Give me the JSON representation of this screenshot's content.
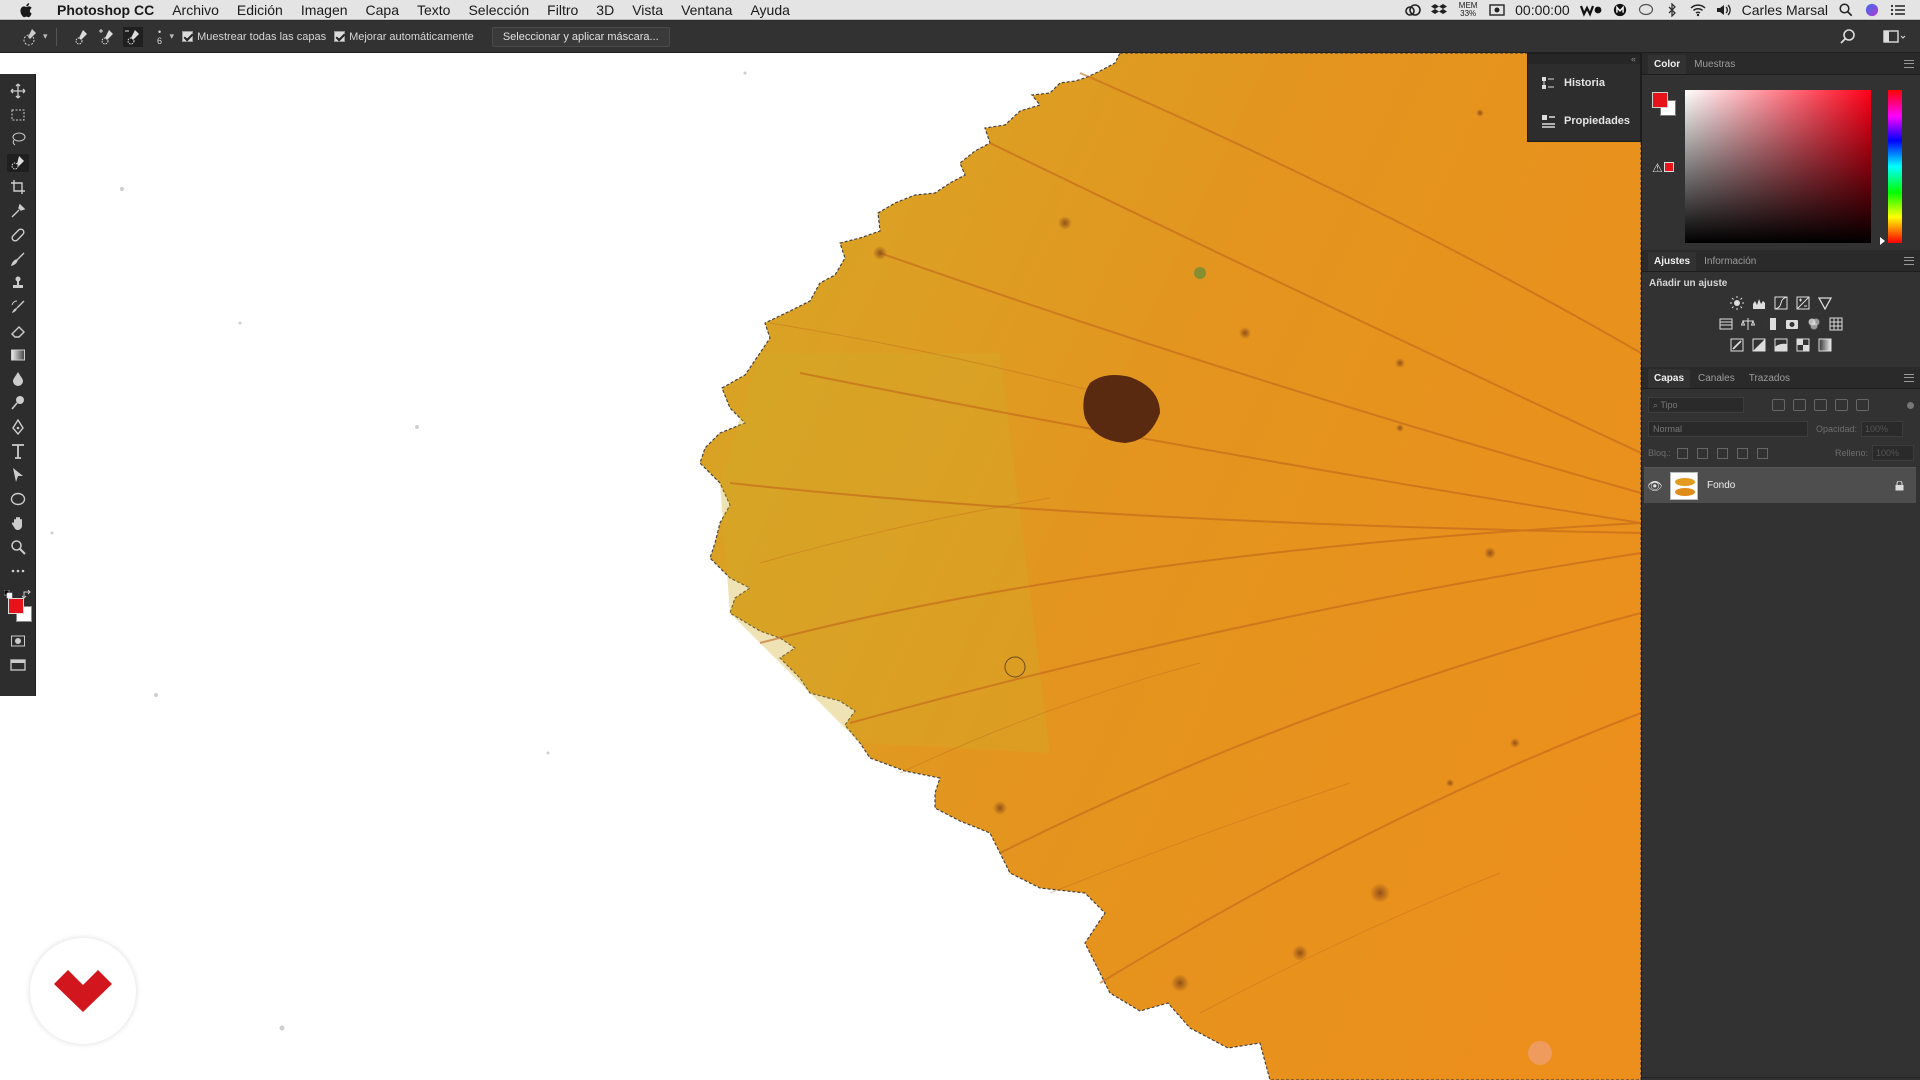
{
  "menubar": {
    "app_name": "Photoshop CC",
    "items": [
      "Archivo",
      "Edición",
      "Imagen",
      "Capa",
      "Texto",
      "Selección",
      "Filtro",
      "3D",
      "Vista",
      "Ventana",
      "Ayuda"
    ],
    "mem_label": "MEM",
    "mem_value": "33%",
    "clock": "00:00:00",
    "user": "Carles Marsal"
  },
  "options_bar": {
    "brush_size": "6",
    "sample_all_layers": "Muestrear todas las capas",
    "auto_enhance": "Mejorar automáticamente",
    "select_and_mask": "Seleccionar y aplicar máscara..."
  },
  "collapsed_panels": {
    "history": "Historia",
    "properties": "Propiedades"
  },
  "color_panel": {
    "tabs": [
      "Color",
      "Muestras"
    ],
    "foreground_color": "#e8131a",
    "background_color": "#ffffff"
  },
  "adjustments_panel": {
    "tabs": [
      "Ajustes",
      "Información"
    ],
    "title": "Añadir un ajuste"
  },
  "layers_panel": {
    "tabs": [
      "Capas",
      "Canales",
      "Trazados"
    ],
    "filter_placeholder": "Tipo",
    "blend_mode": "Normal",
    "opacity_label": "Opacidad:",
    "opacity_value": "100%",
    "lock_label": "Bloq.:",
    "fill_label": "Relleno:",
    "fill_value": "100%",
    "layers": [
      {
        "name": "Fondo",
        "visible": true,
        "locked": true
      }
    ]
  },
  "colors": {
    "accent_red": "#e8131a",
    "leaf_orange": "#e8951f",
    "ui_dark": "#323232"
  }
}
